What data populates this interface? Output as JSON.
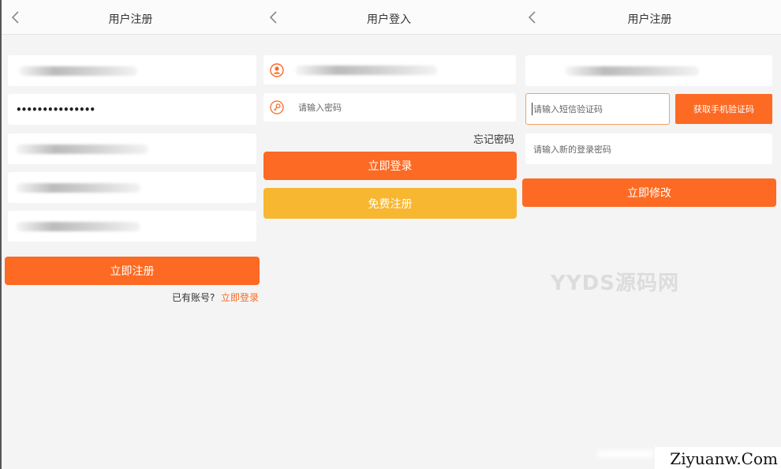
{
  "register": {
    "title": "用户注册",
    "password_mask": "•••••••••••••••",
    "submit": "立即注册",
    "have_account": "已有账号?",
    "login_link": "立即登录"
  },
  "login": {
    "title": "用户登入",
    "password_placeholder": "请输入密码",
    "forgot": "忘记密码",
    "submit": "立即登录",
    "register": "免费注册"
  },
  "reset": {
    "title": "用户注册",
    "sms_placeholder": "请输入短信验证码",
    "get_code": "获取手机验证码",
    "new_password_placeholder": "请输入新的登录密码",
    "submit": "立即修改"
  },
  "watermark": "YYDS源码网",
  "site_mark": "Ziyuanw.Com",
  "colors": {
    "accent": "#fc6a23",
    "secondary": "#f7b731",
    "background": "#f4f4f4"
  },
  "icons": [
    "chevron-left-icon",
    "user-icon",
    "key-icon"
  ]
}
